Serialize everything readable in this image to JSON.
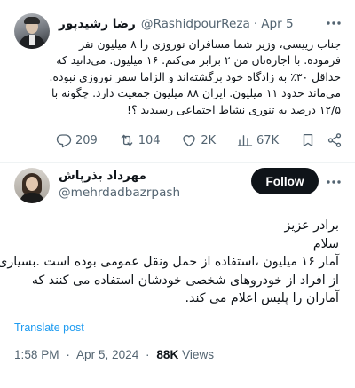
{
  "parent_tweet": {
    "author_name": "رضا رشیدپور",
    "handle": "@RashidpourReza",
    "separator": "·",
    "date": "Apr 5",
    "lines": [
      "جناب رییسی، وزیر شما مسافران نوروزی را ۸ میلیون نفر",
      "فرموده. با اجازه‌تان من ۲ برابر می‌کنم. ۱۶ میلیون. می‌دانید که",
      "حداقل ۳۰٪ به زادگاه خود برگشته‌اند و الزاما سفر نوروزی نبوده.",
      "می‌ماند حدود ۱۱ میلیون. ایران ۸۸ میلیون جمعیت دارد. چگونه با",
      "۱۲/۵ درصد به تنوری نشاط اجتماعی رسیدید ؟!"
    ],
    "actions": {
      "replies": "209",
      "reposts": "104",
      "likes": "2K",
      "views": "67K"
    },
    "icons": [
      "reply-icon",
      "repost-icon",
      "like-icon",
      "views-icon",
      "bookmark-icon",
      "share-icon",
      "more-icon"
    ]
  },
  "reply_tweet": {
    "author_name": "مهرداد بذرپاش",
    "handle": "@mehrdadbazrpash",
    "follow_label": "Follow",
    "lines": [
      "برادر عزیز",
      "سلام",
      "آمار ۱۶ میلیون ،استفاده از حمل ونقل عمومی بوده است .بسیاری",
      "از افراد از خودروهای شخصی خودشان استفاده می کنند که",
      "آماران را پلیس اعلام می کند."
    ],
    "translate_label": "Translate post",
    "time": "1:58 PM",
    "separator": "·",
    "date": "Apr 5, 2024",
    "views_count": "88K",
    "views_label": "Views"
  },
  "colors": {
    "text_primary": "#0f1419",
    "text_secondary": "#536471",
    "link": "#1d9bf0",
    "button_bg": "#0f1419",
    "button_text": "#ffffff",
    "divider": "#eff3f4"
  }
}
